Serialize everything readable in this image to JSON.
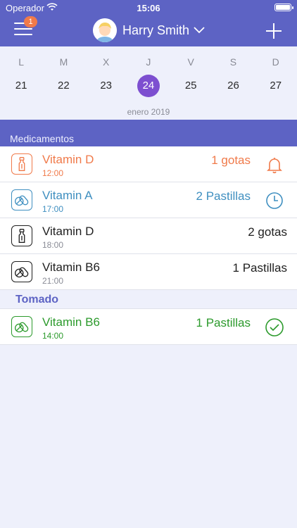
{
  "status_bar": {
    "carrier": "Operador",
    "time": "15:06"
  },
  "nav": {
    "badge": "1",
    "profile_name": "Harry Smith"
  },
  "calendar": {
    "weekdays": [
      "L",
      "M",
      "X",
      "J",
      "V",
      "S",
      "D"
    ],
    "days": [
      "21",
      "22",
      "23",
      "24",
      "25",
      "26",
      "27"
    ],
    "selected_day": "24",
    "month_label": "enero 2019"
  },
  "section": {
    "title": "Medicamentos"
  },
  "medications": [
    {
      "name": "Vitamin D",
      "time": "12:00",
      "dose": "1 gotas",
      "icon": "dropper-icon",
      "status_icon": "bell-icon",
      "color": "#f07a4a"
    },
    {
      "name": "Vitamin A",
      "time": "17:00",
      "dose": "2 Pastillas",
      "icon": "pills-icon",
      "status_icon": "clock-icon",
      "color": "#3f8fc0"
    },
    {
      "name": "Vitamin D",
      "time": "18:00",
      "dose": "2 gotas",
      "icon": "dropper-icon",
      "status_icon": "",
      "color": "#1f1f1f"
    },
    {
      "name": "Vitamin B6",
      "time": "21:00",
      "dose": "1 Pastillas",
      "icon": "pills-icon",
      "status_icon": "",
      "color": "#1f1f1f"
    }
  ],
  "taken": {
    "title": "Tomado",
    "items": [
      {
        "name": "Vitamin B6",
        "time": "14:00",
        "dose": "1 Pastillas",
        "icon": "pills-icon",
        "status_icon": "check-circle-icon",
        "color": "#2c9a2c"
      }
    ]
  }
}
